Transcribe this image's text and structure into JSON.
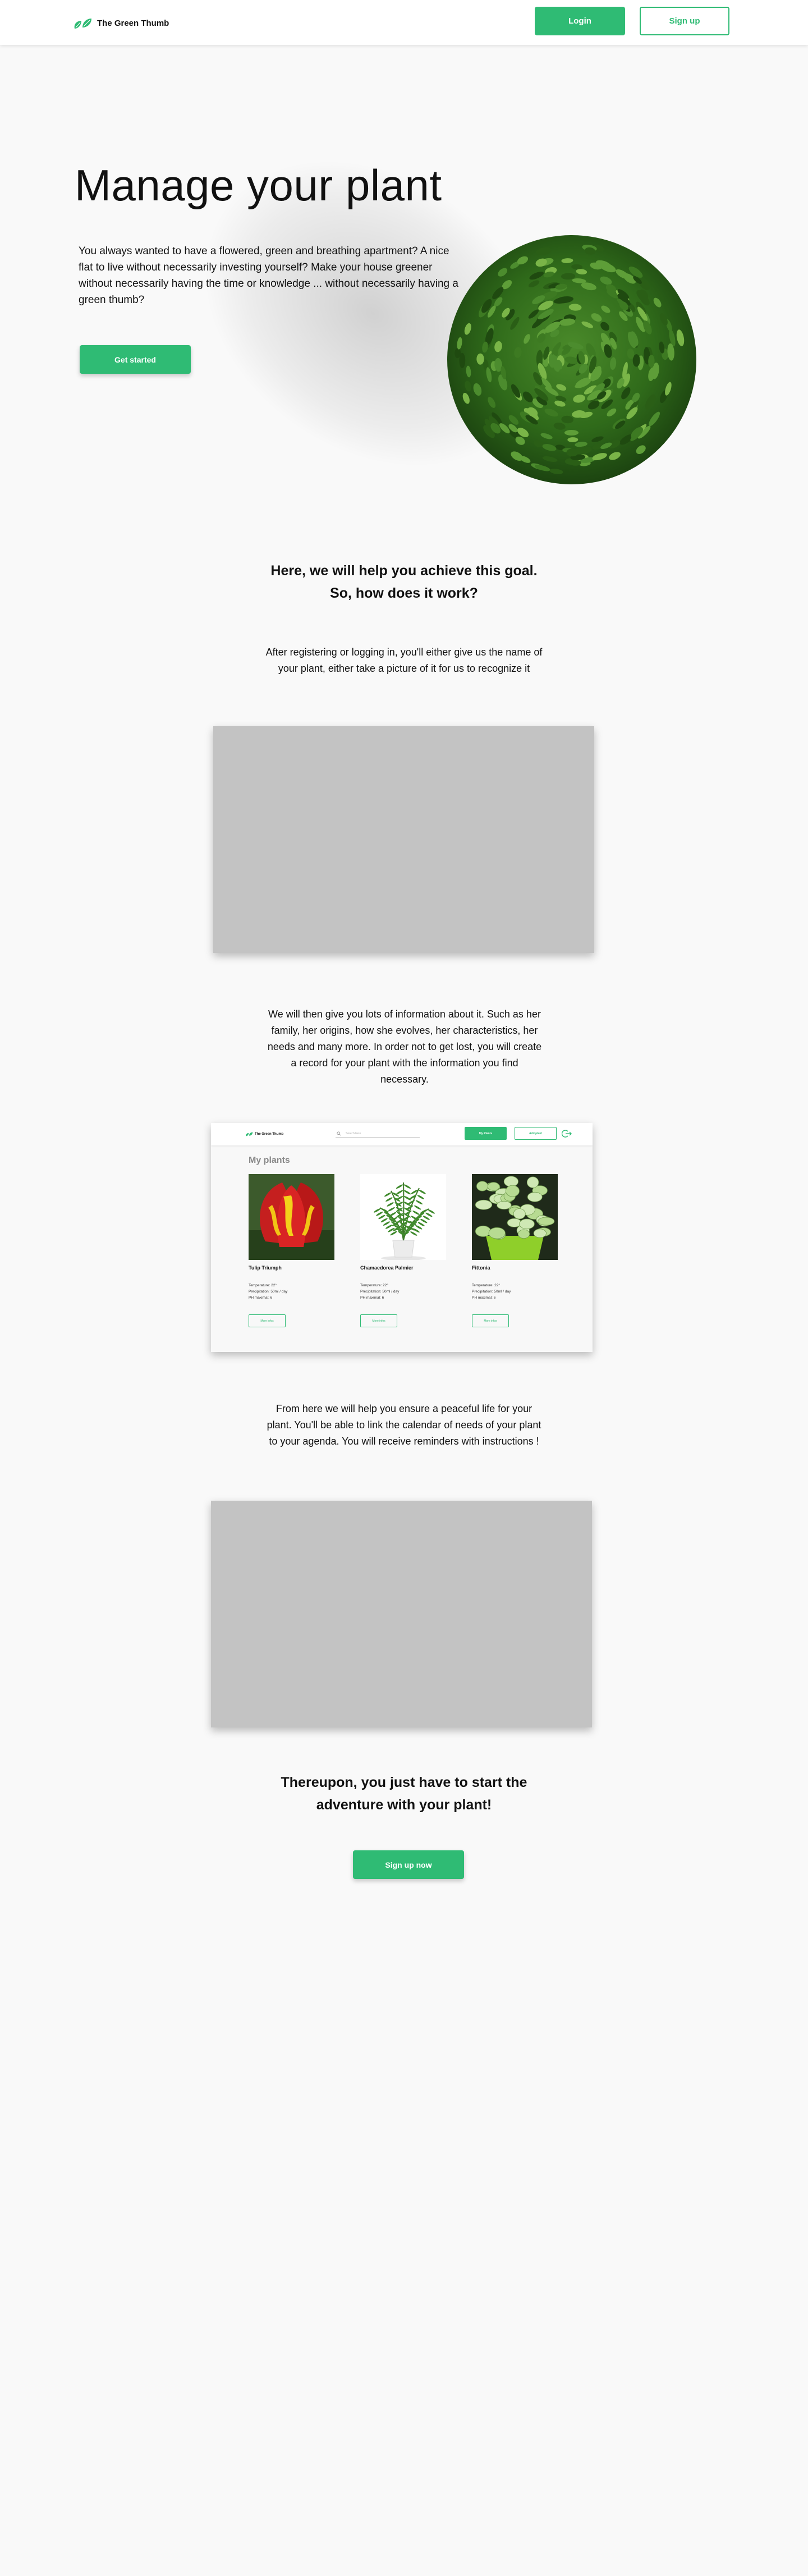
{
  "header": {
    "brand": "The Green Thumb",
    "login_label": "Login",
    "signup_label": "Sign up"
  },
  "hero": {
    "title": "Manage your plant",
    "text": "You always wanted to have a flowered, green and breathing apartment? A nice flat to live without necessarily investing yourself? Make your house greener without necessarily having the time or knowledge ... without necessarily having a green thumb?",
    "cta_label": "Get started"
  },
  "how": {
    "title_line1": "Here, we will help you achieve this goal.",
    "title_line2": "So, how does it work?",
    "step1": "After registering or logging in, you'll either give us the name of your plant, either take a picture of it for us to recognize it",
    "step2": "We will then give you lots of information about it. Such as her family, her origins, how she evolves, her characteristics, her needs and many more. In order not to get lost, you will create a record for your plant with the information you find necessary.",
    "step3": "From here we will help you ensure a peaceful life for your plant. You'll be able to link the calendar of needs of your plant to your agenda. You will receive reminders with instructions !"
  },
  "mock": {
    "brand": "The Green Thumb",
    "search_placeholder": "Search here",
    "plants_button": "My Plants",
    "add_button": "Add plant",
    "title": "My plants",
    "cards": [
      {
        "name": "Tulip Triumph",
        "info1": "Temperature: 22°",
        "info2": "Precipitation: 50ml / day",
        "info3": "PH maximal: 6",
        "button": "More infos"
      },
      {
        "name": "Chamaedorea Palmier",
        "info1": "Temperature: 22°",
        "info2": "Precipitation: 50ml / day",
        "info3": "PH maximal: 6",
        "button": "More infos"
      },
      {
        "name": "Fittonia",
        "info1": "Temperature: 22°",
        "info2": "Precipitation: 50ml / day",
        "info3": "PH maximal: 6",
        "button": "More infos"
      }
    ]
  },
  "closing": {
    "title_line1": "Thereupon, you just have to start the",
    "title_line2": "adventure with your plant!",
    "cta_label": "Sign up now"
  },
  "colors": {
    "accent": "#2fbb74",
    "background": "#f9f9f9",
    "placeholder": "#c3c3c3"
  },
  "icons": [
    "leaf-logo-icon",
    "search-icon",
    "logout-icon"
  ]
}
